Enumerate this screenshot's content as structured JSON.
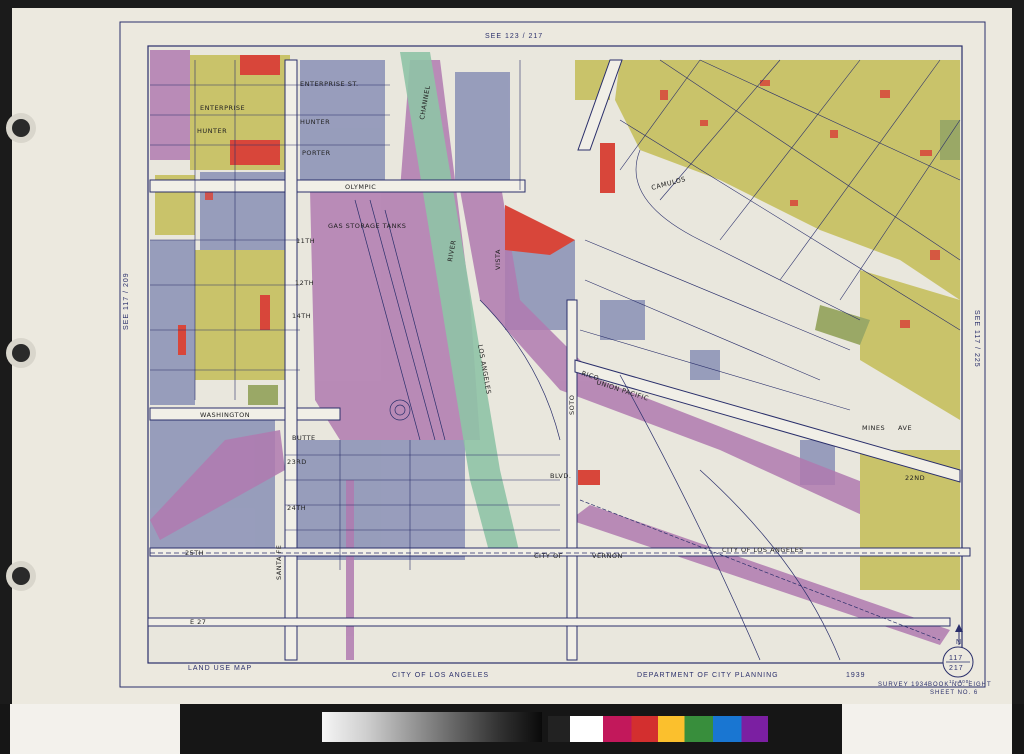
{
  "sheet": {
    "header_ref": "SEE  123  /  217",
    "left_ref": "SEE  117  /  209",
    "right_ref": "SEE  117  /  225",
    "footer_left": "LAND  USE  MAP",
    "footer_center": "CITY  OF  LOS  ANGELES",
    "footer_right": "DEPARTMENT  OF  CITY  PLANNING",
    "year": "1939",
    "survey": "SURVEY 1934",
    "book": "BOOK  NO. EIGHT",
    "sheet_no": "SHEET  NO.  6",
    "north": "N",
    "index_top": "117",
    "index_bottom": "217",
    "scale": "1\"=300'"
  },
  "streets": {
    "olympic": "OLYMPIC",
    "washington": "WASHINGTON",
    "enterprise": "ENTERPRISE  ST.",
    "enterprise2": "ENTERPRISE",
    "hunter": "HUNTER",
    "hunter2": "HUNTER",
    "porter": "PORTER",
    "camulos": "CAMULOS",
    "vista": "VISTA",
    "rico": "RICO",
    "union_pacific": "UNION  PACIFIC",
    "city_la": "CITY  OF  LOS  ANGELES",
    "city_of": "CITY  OF",
    "vernon": "VERNON",
    "channel": "CHANNEL",
    "river": "RIVER",
    "los_angeles": "LOS   ANGELES",
    "soto": "SOTO",
    "santa_fe": "SANTA  FE",
    "st25": "25TH",
    "e27": "E 27",
    "st24": "24TH",
    "st23": "23RD",
    "st12": "12TH",
    "st11": "11TH",
    "st14": "14TH",
    "butte": "BUTTE",
    "blvd": "BLVD.",
    "mines": "MINES",
    "ave": "AVE",
    "st22": "22ND",
    "gas_tanks": "GAS  STORAGE  TANKS"
  },
  "colors": {
    "background": "#ece9df",
    "industrial": "#8f95b8",
    "railroad": "#b07ab0",
    "river": "#8fc3a6",
    "commercial": "#d8463a",
    "residential": "#c9c36a",
    "park": "#9aa866",
    "ink": "#2a2f6b"
  }
}
